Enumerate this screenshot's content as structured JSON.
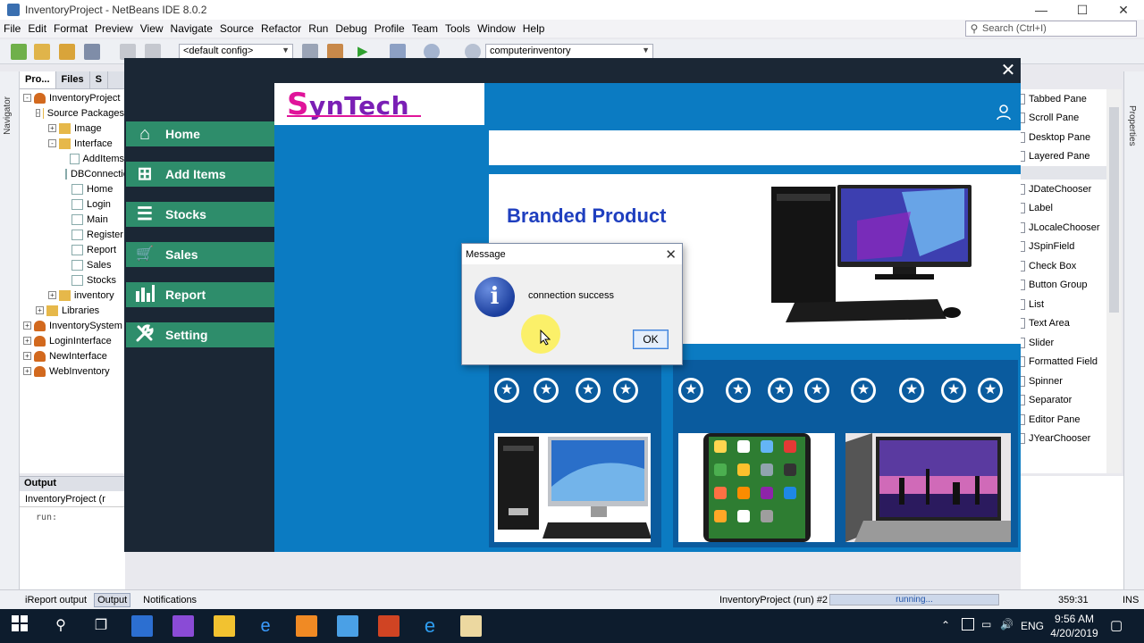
{
  "ide": {
    "title": "InventoryProject - NetBeans IDE 8.0.2",
    "menu": [
      "File",
      "Edit",
      "Format",
      "Preview",
      "View",
      "Navigate",
      "Source",
      "Refactor",
      "Run",
      "Debug",
      "Profile",
      "Team",
      "Tools",
      "Window",
      "Help"
    ],
    "search_placeholder": "Search (Ctrl+I)",
    "config_combo": "<default config>",
    "project_combo": "computerinventory",
    "navigator_label": "Navigator",
    "properties_label": "Properties",
    "project_tabs": [
      "Pro...",
      "Files",
      "S"
    ],
    "tree": [
      {
        "label": "InventoryProject",
        "level": 0,
        "kind": "proj",
        "exp": "-"
      },
      {
        "label": "Source Packages",
        "level": 1,
        "kind": "pkg",
        "exp": "-"
      },
      {
        "label": "Image",
        "level": 2,
        "kind": "pkg",
        "exp": "+"
      },
      {
        "label": "Interface",
        "level": 2,
        "kind": "pkg",
        "exp": "-"
      },
      {
        "label": "AddItems",
        "level": 3,
        "kind": "file",
        "exp": ""
      },
      {
        "label": "DBConnection",
        "level": 3,
        "kind": "file",
        "exp": ""
      },
      {
        "label": "Home",
        "level": 3,
        "kind": "file",
        "exp": ""
      },
      {
        "label": "Login",
        "level": 3,
        "kind": "file",
        "exp": ""
      },
      {
        "label": "Main",
        "level": 3,
        "kind": "file",
        "exp": ""
      },
      {
        "label": "Register",
        "level": 3,
        "kind": "file",
        "exp": ""
      },
      {
        "label": "Report",
        "level": 3,
        "kind": "file",
        "exp": ""
      },
      {
        "label": "Sales",
        "level": 3,
        "kind": "file",
        "exp": ""
      },
      {
        "label": "Stocks",
        "level": 3,
        "kind": "file",
        "exp": ""
      },
      {
        "label": "inventory",
        "level": 2,
        "kind": "pkg",
        "exp": "+"
      },
      {
        "label": "Libraries",
        "level": 1,
        "kind": "pkg",
        "exp": "+"
      },
      {
        "label": "InventorySystem",
        "level": 0,
        "kind": "proj",
        "exp": "+"
      },
      {
        "label": "LoginInterface",
        "level": 0,
        "kind": "proj",
        "exp": "+"
      },
      {
        "label": "NewInterface",
        "level": 0,
        "kind": "proj",
        "exp": "+"
      },
      {
        "label": "WebInventory",
        "level": 0,
        "kind": "proj",
        "exp": "+"
      }
    ],
    "output": {
      "header": "Output",
      "tab": "InventoryProject (r",
      "text": "run:"
    },
    "palette": [
      "Tabbed Pane",
      "Scroll Pane",
      "Desktop Pane",
      "Layered Pane",
      "",
      "JDateChooser",
      "Label",
      "JLocaleChooser",
      "JSpinField",
      "Check Box",
      "Button Group",
      "List",
      "Text Area",
      "Slider",
      "Formatted Field",
      "Spinner",
      "Separator",
      "Editor Pane",
      "JYearChooser"
    ],
    "status": {
      "tabs": [
        "iReport output",
        "Output",
        "Notifications"
      ],
      "run_label": "InventoryProject (run) #2",
      "progress_text": "running...",
      "position": "359:31",
      "insert_mode": "INS"
    }
  },
  "app": {
    "logo": {
      "first": "S",
      "rest": "ynTech"
    },
    "menu": [
      {
        "label": "Home",
        "icon": "home-icon",
        "glyph": "⌂"
      },
      {
        "label": "Add Items",
        "icon": "add-icon",
        "glyph": "⊞"
      },
      {
        "label": "Stocks",
        "icon": "stack-icon",
        "glyph": "☰"
      },
      {
        "label": "Sales",
        "icon": "cart-icon",
        "glyph": "🛒"
      },
      {
        "label": "Report",
        "icon": "bar-chart-icon",
        "glyph": "▮"
      },
      {
        "label": "Setting",
        "icon": "wrench-icon",
        "glyph": "✕"
      }
    ],
    "banner_title": "Branded Product",
    "star_glyph": "★"
  },
  "dialog": {
    "title": "Message",
    "message": "connection success",
    "ok": "OK",
    "icon_glyph": "i"
  },
  "taskbar": {
    "time": "9:56 AM",
    "date": "4/20/2019",
    "lang": "ENG"
  }
}
